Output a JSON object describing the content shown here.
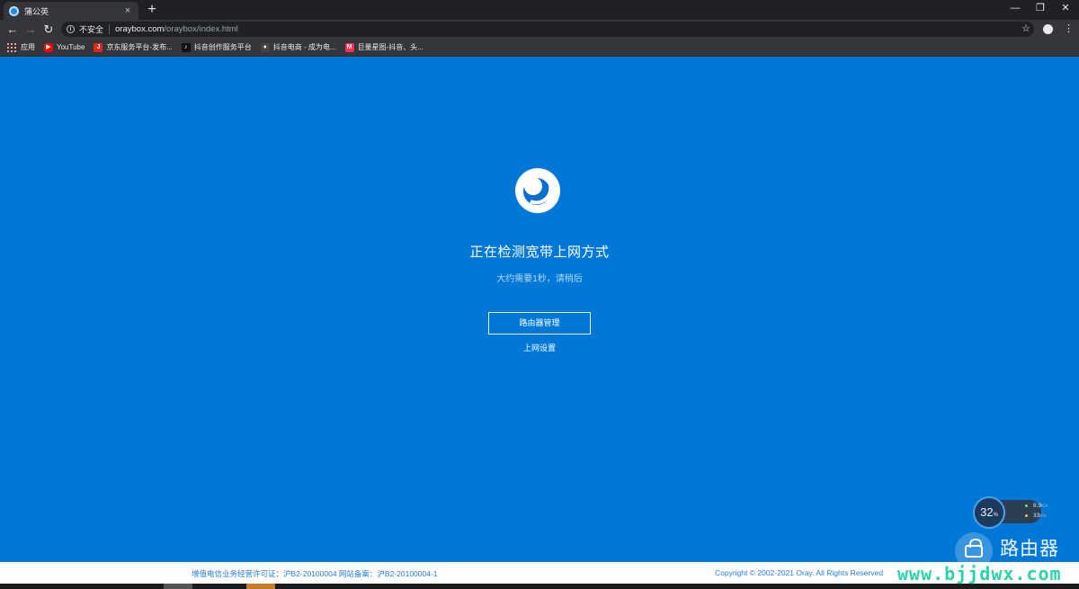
{
  "browser": {
    "tab_title": "蒲公英",
    "tab_close": "×",
    "new_tab": "+",
    "window_controls": [
      "—",
      "❐",
      "✕"
    ],
    "nav": {
      "back": "←",
      "forward": "→",
      "reload": "↻"
    },
    "security_label": "不安全",
    "url_host": "oraybox.com",
    "url_path": "/oraybox/index.html",
    "star": "☆",
    "menu": "⋮",
    "bookmarks": [
      {
        "label": "应用",
        "icon": "apps-grid"
      },
      {
        "label": "YouTube",
        "icon": "youtube-icon",
        "color": "#ff0000"
      },
      {
        "label": "京东服务平台-发布...",
        "icon": "jd-icon",
        "color": "#e1251b"
      },
      {
        "label": "抖音创作服务平台",
        "icon": "tiktok-icon",
        "color": "#111111"
      },
      {
        "label": "抖音电商 - 成为电...",
        "icon": "douyin-shop-icon",
        "color": "#222222"
      },
      {
        "label": "巨量星图-抖音、头...",
        "icon": "xingtu-icon",
        "color": "#ff2c55"
      }
    ]
  },
  "page": {
    "heading": "正在检测宽带上网方式",
    "subheading": "大约需要1秒，请稍后",
    "router_button": "路由器管理",
    "network_link": "上网设置",
    "footer_license": "增值电信业务经营许可证：沪B2-20100004 网站备案：沪B2-20100004-1",
    "footer_copyright": "Copyright © 2002-2021 Oray. All Rights Reserved"
  },
  "speed_widget": {
    "percent": "32",
    "percent_unit": "%",
    "upload": "8.9",
    "upload_unit": "K/s",
    "download": "33",
    "download_unit": "K/s"
  },
  "watermark": {
    "title": "路由器",
    "domain": "www.bjjdwx.com"
  },
  "colors": {
    "page_bg": "#0078d7",
    "footer_text": "#1f7ed6",
    "watermark_domain": "#2bd4a8"
  }
}
